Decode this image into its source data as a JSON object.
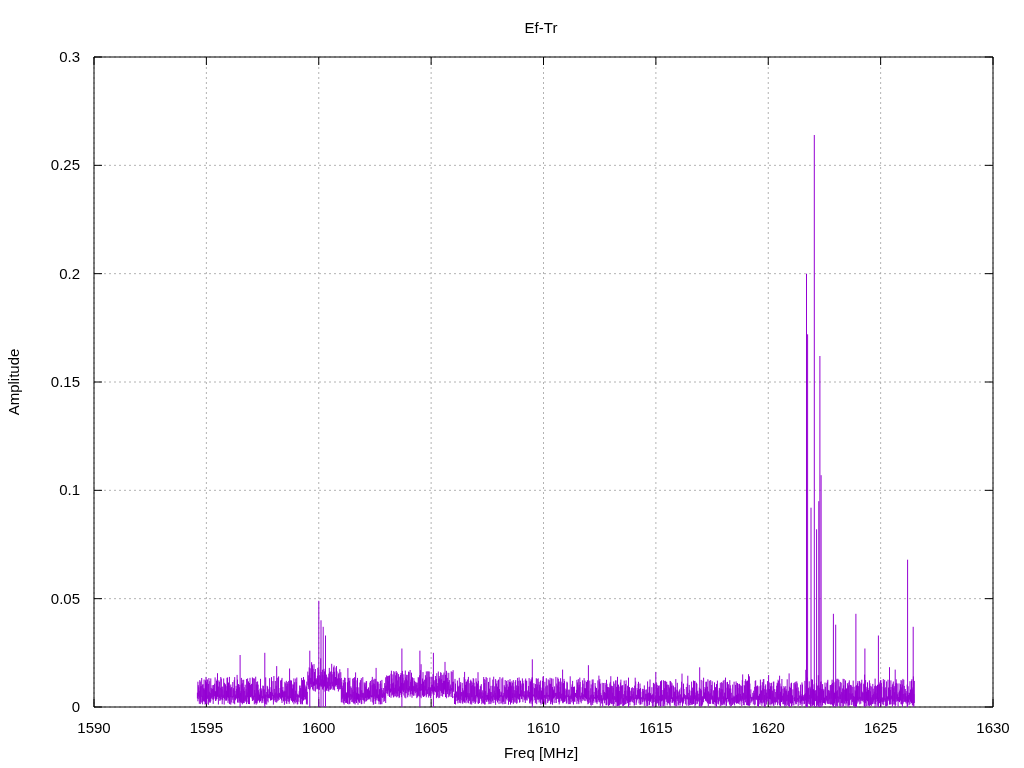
{
  "plot": {
    "chart_data": {
      "type": "line",
      "title": "Ef-Tr",
      "xlabel": "Freq [MHz]",
      "ylabel": "Amplitude",
      "xlim": [
        1590,
        1630
      ],
      "ylim": [
        0,
        0.3
      ],
      "grid": true,
      "xticks": [
        {
          "value": 1590,
          "label": "1590"
        },
        {
          "value": 1595,
          "label": "1595"
        },
        {
          "value": 1600,
          "label": "1600"
        },
        {
          "value": 1605,
          "label": "1605"
        },
        {
          "value": 1610,
          "label": "1610"
        },
        {
          "value": 1615,
          "label": "1615"
        },
        {
          "value": 1620,
          "label": "1620"
        },
        {
          "value": 1625,
          "label": "1625"
        },
        {
          "value": 1630,
          "label": "1630"
        }
      ],
      "yticks": [
        {
          "value": 0,
          "label": "0"
        },
        {
          "value": 0.05,
          "label": "0.05"
        },
        {
          "value": 0.1,
          "label": "0.1"
        },
        {
          "value": 0.15,
          "label": "0.15"
        },
        {
          "value": 0.2,
          "label": "0.2"
        },
        {
          "value": 0.25,
          "label": "0.25"
        },
        {
          "value": 0.3,
          "label": "0.3"
        }
      ]
    }
  }
}
